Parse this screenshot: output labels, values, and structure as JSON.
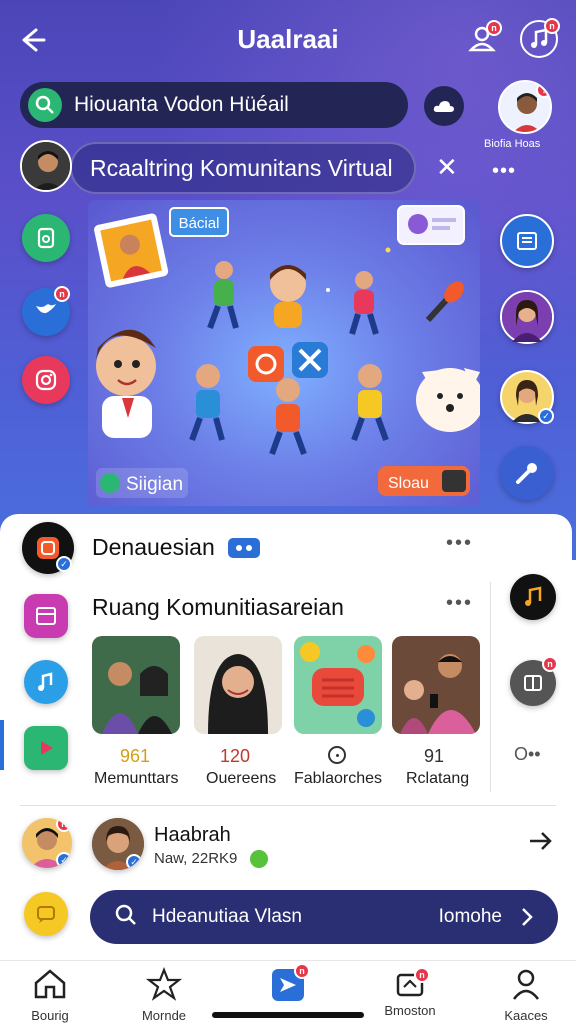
{
  "header": {
    "title": "Uaalraai"
  },
  "search": {
    "text": "Hiouanta Vodon Hüéail"
  },
  "room": {
    "title": "Rcaaltring Komunitans Virtual"
  },
  "right_profile": {
    "label": "Biofia Hoas"
  },
  "banner": {
    "tag": "Bácial",
    "left_button": "Siigian",
    "right_button": "Sloau"
  },
  "section1": {
    "title": "Denauesian"
  },
  "section2": {
    "title": "Ruang Komunitiasareian",
    "stats": [
      {
        "value": "961",
        "label": "Memunttars",
        "color": "#d4a017"
      },
      {
        "value": "120",
        "label": "Ouereens",
        "color": "#c0392b"
      },
      {
        "value": "",
        "label": "Fablaorches",
        "color": "#333333"
      },
      {
        "value": "91",
        "label": "Rclatang",
        "color": "#333333"
      }
    ],
    "more_text": "O••"
  },
  "person": {
    "name": "Haabrah",
    "sub": "Naw, 22RK9"
  },
  "bottom_search": {
    "query": "Hdeanutiaa Vlasn",
    "right": "Iomohe"
  },
  "nav": [
    {
      "label": "Bourig",
      "icon": "home-icon"
    },
    {
      "label": "Mornde",
      "icon": "star-icon"
    },
    {
      "label": "",
      "icon": "send-icon"
    },
    {
      "label": "Bmoston",
      "icon": "inbox-icon"
    },
    {
      "label": "Kaaces",
      "icon": "profile-icon"
    }
  ],
  "colors": {
    "accent": "#4b46b8",
    "dark_pill": "#232555",
    "badge": "#e5374a"
  }
}
